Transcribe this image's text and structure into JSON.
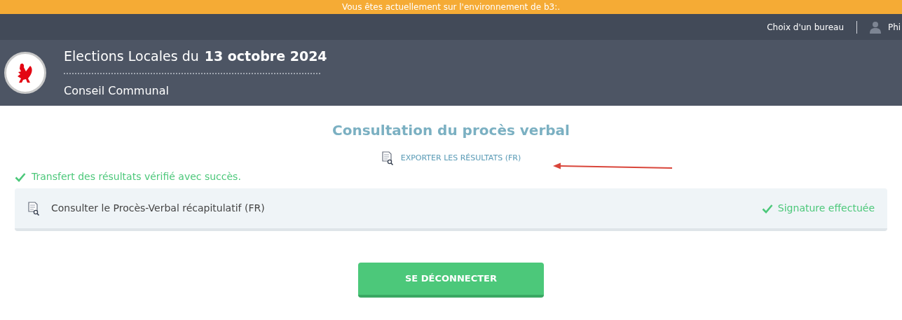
{
  "banner": "Vous êtes actuellement sur l'environnement de b3:.",
  "nav": {
    "office_link": "Choix d'un bureau",
    "user": "Phi"
  },
  "header": {
    "title": "Elections Locales du",
    "date": "13 octobre 2024",
    "subtitle": "Conseil Communal"
  },
  "page_title": "Consultation du procès verbal",
  "export_link": "EXPORTER LES RÉSULTATS (FR)",
  "success_message": "Transfert des résultats vérifié avec succès.",
  "documents": [
    {
      "label": "Consulter le Procès-Verbal récapitulatif (FR)",
      "status": "Signature effectuée",
      "signed": true
    }
  ],
  "logout_button": "SE DÉCONNECTER"
}
